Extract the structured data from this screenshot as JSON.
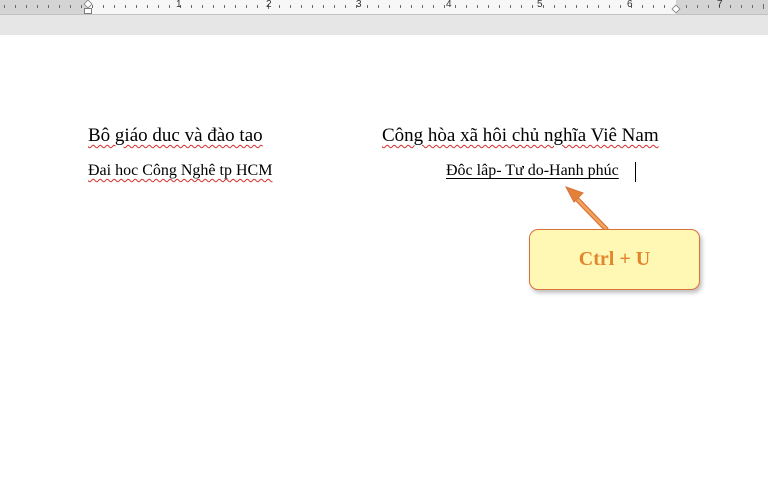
{
  "ruler": {
    "numbers": [
      "1",
      "2",
      "3",
      "4",
      "5",
      "6",
      "7"
    ]
  },
  "document": {
    "left_line1": "Bô giáo duc và đào tao",
    "left_line2": "Đai hoc Công Nghê tp HCM",
    "right_line1": "Công hòa xã hôi chủ nghĩa Viê Nam",
    "right_line2": "Đôc lâp- Tư do-Hanh phúc"
  },
  "callout": {
    "label": "Ctrl + U"
  },
  "colors": {
    "callout_fill": "#fff7b4",
    "callout_border": "#d9733c",
    "callout_text": "#e2852c",
    "spell_squiggle": "#d62b2b"
  }
}
